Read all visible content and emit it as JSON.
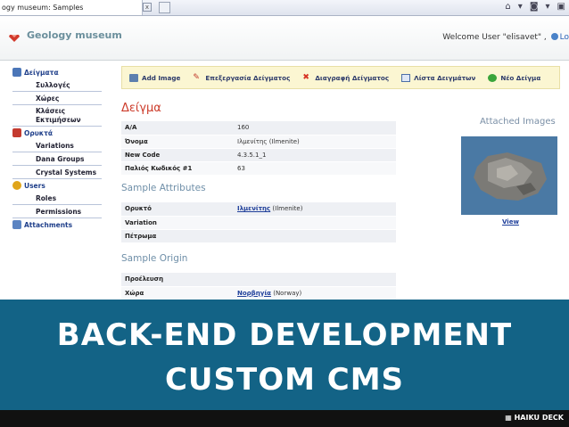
{
  "browser": {
    "tab_title": "ogy museum: Samples",
    "tab_close": "x",
    "icons": [
      "home-icon",
      "rss-icon",
      "print-icon"
    ]
  },
  "header": {
    "app_name": "Geology museum",
    "welcome_text": "Welcome User \"elisavet\" ,",
    "logout_text": "Lo"
  },
  "sidebar": {
    "groups": [
      {
        "label": "Δείγματα",
        "icon": "samples-icon",
        "items": [
          "Συλλογές",
          "Χώρες",
          "Κλάσεις Εκτιμήσεων"
        ]
      },
      {
        "label": "Ορυκτά",
        "icon": "minerals-icon",
        "items": [
          "Variations",
          "Dana Groups",
          "Crystal Systems"
        ]
      },
      {
        "label": "Users",
        "icon": "users-icon",
        "items": [
          "Roles",
          "Permissions"
        ]
      },
      {
        "label": "Attachments",
        "icon": "attachments-icon",
        "items": []
      }
    ]
  },
  "toolbar": {
    "buttons": [
      {
        "label": "Add Image",
        "icon": "add-image-icon"
      },
      {
        "label": "Επεξεργασία Δείγματος",
        "icon": "edit-pencil-icon"
      },
      {
        "label": "Διαγραφή Δείγματος",
        "icon": "delete-x-icon"
      },
      {
        "label": "Λίστα Δειγμάτων",
        "icon": "list-icon"
      },
      {
        "label": "Νέο Δείγμα",
        "icon": "new-green-icon"
      }
    ]
  },
  "main": {
    "title": "Δείγμα",
    "details": [
      {
        "key": "Α/Α",
        "value": "160"
      },
      {
        "key": "Όνομα",
        "value": "Ιλμενίτης (Ilmenite)"
      },
      {
        "key": "New Code",
        "value": "4.3.5.1_1"
      },
      {
        "key": "Παλιός Κωδικός #1",
        "value": "63"
      }
    ],
    "attributes_title": "Sample Attributes",
    "attributes": [
      {
        "key": "Ορυκτό",
        "link": "Ιλμενίτης",
        "value": "(Ilmenite)"
      },
      {
        "key": "Variation",
        "link": "",
        "value": ""
      },
      {
        "key": "Πέτρωμα",
        "link": "",
        "value": ""
      }
    ],
    "origin_title": "Sample Origin",
    "origin": [
      {
        "key": "Προέλευση",
        "link": "",
        "value": ""
      },
      {
        "key": "Χώρα",
        "link": "Νορβηγία",
        "value": "(Norway)"
      }
    ],
    "attached_title": "Attached Images",
    "view_label": "View"
  },
  "banner": {
    "line1": "BACK-END DEVELOPMENT",
    "line2": "CUSTOM CMS",
    "brand": "HAIKU DECK"
  }
}
